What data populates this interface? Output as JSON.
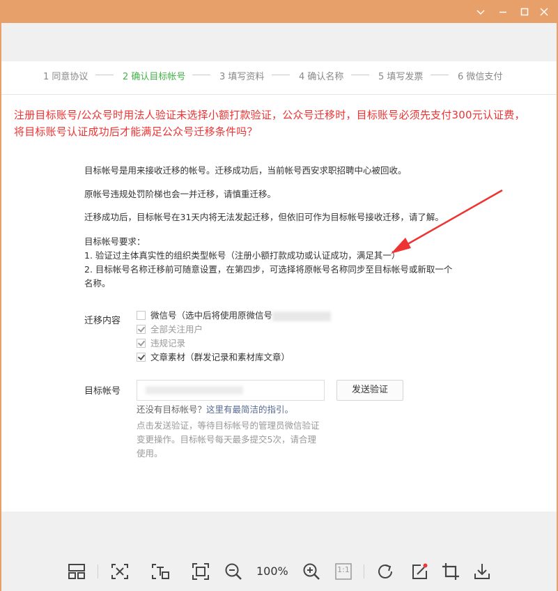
{
  "window": {
    "controls": [
      "chevron-down-icon",
      "minimize-icon",
      "maximize-icon",
      "close-icon"
    ],
    "titlebar_color": "#e8a06a"
  },
  "steps": [
    {
      "label": "1 同意协议",
      "active": false
    },
    {
      "label": "2 确认目标帐号",
      "active": true
    },
    {
      "label": "3 填写资料",
      "active": false
    },
    {
      "label": "4 确认名称",
      "active": false
    },
    {
      "label": "5 填写发票",
      "active": false
    },
    {
      "label": "6 微信支付",
      "active": false
    }
  ],
  "question": {
    "line1": "注册目标账号/公众号时用法人验证未选择小额打款验证，公众号迁移时，目标账号必须先支付300元认证费，",
    "line2": "将目标账号认证成功后才能满足公众号迁移条件吗？",
    "color": "#ee3333"
  },
  "intro": {
    "p1": "目标帐号是用来接收迁移的帐号。迁移成功后，当前帐号西安求职招聘中心被回收。",
    "p2": "原帐号违规处罚阶梯也会一并迁移，请慎重迁移。",
    "p3": "迁移成功后，目标帐号在31天内将无法发起迁移，但依旧可作为目标帐号接收迁移，请了解。",
    "req_title": "目标帐号要求：",
    "req1": "1. 验证过主体真实性的组织类型帐号（注册小额打款成功或认证成功，满足其一）",
    "req2_a": "2. 目标帐号名称迁移前可随意设置，在第四步，可选择将原帐号名称同步至目标帐号或新取一个",
    "req2_b": "名称。"
  },
  "migrate": {
    "label": "迁移内容",
    "options": [
      {
        "label": "微信号（选中后将使用原微信号",
        "checked": false,
        "disabled": false
      },
      {
        "label": "全部关注用户",
        "checked": true,
        "disabled": true
      },
      {
        "label": "违规记录",
        "checked": true,
        "disabled": true
      },
      {
        "label": "文章素材（群发记录和素材库文章）",
        "checked": true,
        "disabled": false
      }
    ]
  },
  "target": {
    "label": "目标帐号",
    "send_button": "发送验证",
    "hint_prefix": "还没有目标帐号？",
    "hint_link": "这里有最简洁的指引。",
    "note1": "点击发送验证，等待目标帐号的管理员微信验证",
    "note2": "变更操作。目标帐号每天最多提交5次，请合理",
    "note3": "使用。"
  },
  "toolbar": {
    "zoom": "100%",
    "actual_size": "1:1",
    "icons": [
      "layout-icon",
      "scan-icon",
      "text-extract-icon",
      "fit-screen-icon",
      "zoom-out-icon",
      "zoom-in-icon",
      "actual-size-icon",
      "rotate-icon",
      "edit-icon",
      "crop-icon",
      "download-icon"
    ]
  }
}
